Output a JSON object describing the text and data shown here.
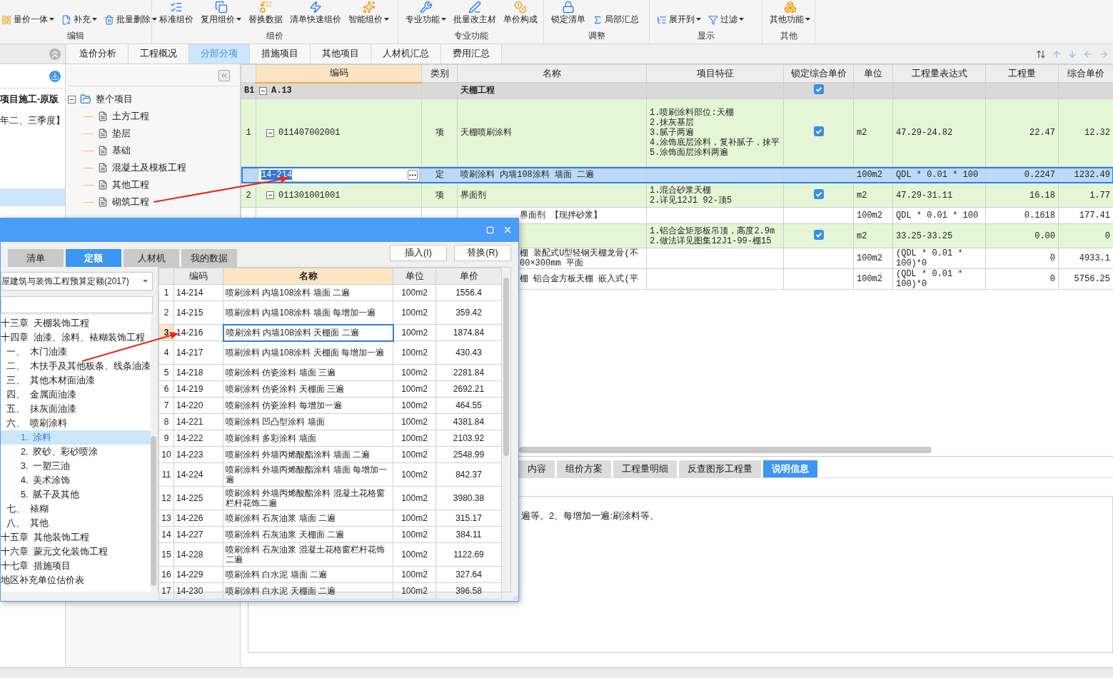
{
  "ribbon": {
    "groups": [
      {
        "label": "编辑",
        "buttons": [
          {
            "label": "量价一体",
            "kind": "small",
            "dropdown": true
          },
          {
            "label": "补充",
            "kind": "small",
            "dropdown": true
          },
          {
            "label": "批量删除",
            "kind": "small",
            "dropdown": true
          }
        ]
      },
      {
        "label": "组价",
        "buttons": [
          {
            "label": "标准组价",
            "kind": "large",
            "dropdown": false
          },
          {
            "label": "复用组价",
            "kind": "large",
            "dropdown": true
          },
          {
            "label": "替换数据",
            "kind": "large",
            "dropdown": false
          },
          {
            "label": "清单快速组价",
            "kind": "large",
            "dropdown": false
          },
          {
            "label": "智能组价",
            "kind": "large",
            "dropdown": true
          }
        ]
      },
      {
        "label": "专业功能",
        "buttons": [
          {
            "label": "专业功能",
            "kind": "large",
            "dropdown": true
          },
          {
            "label": "批量改主材",
            "kind": "large",
            "dropdown": false
          },
          {
            "label": "单价构成",
            "kind": "large",
            "dropdown": false
          }
        ]
      },
      {
        "label": "调整",
        "buttons": [
          {
            "label": "锁定清单",
            "kind": "large",
            "dropdown": false
          },
          {
            "label": "局部汇总",
            "kind": "small",
            "dropdown": false
          }
        ]
      },
      {
        "label": "显示",
        "buttons": [
          {
            "label": "展开到",
            "kind": "small",
            "dropdown": true
          },
          {
            "label": "过滤",
            "kind": "small",
            "dropdown": true
          }
        ]
      },
      {
        "label": "其他",
        "buttons": [
          {
            "label": "其他功能",
            "kind": "large",
            "dropdown": true
          }
        ]
      }
    ]
  },
  "main_tabs": [
    {
      "label": "造价分析",
      "selected": false
    },
    {
      "label": "工程概况",
      "selected": false
    },
    {
      "label": "分部分项",
      "selected": true
    },
    {
      "label": "措施项目",
      "selected": false
    },
    {
      "label": "其他项目",
      "selected": false
    },
    {
      "label": "人材机汇总",
      "selected": false
    },
    {
      "label": "费用汇总",
      "selected": false
    }
  ],
  "left_panel": {
    "lines": [
      "项目施工-原版",
      "年二、三季度】"
    ]
  },
  "project_tree": {
    "label": "整个项目",
    "expanded": true,
    "children": [
      {
        "label": "土方工程"
      },
      {
        "label": "垫层"
      },
      {
        "label": "基础"
      },
      {
        "label": "混凝土及模板工程"
      },
      {
        "label": "其他工程"
      },
      {
        "label": "砌筑工程"
      }
    ]
  },
  "main_table": {
    "columns": [
      {
        "label": "编码",
        "selected": true
      },
      {
        "label": "类别",
        "selected": false
      },
      {
        "label": "名称",
        "selected": false
      },
      {
        "label": "项目特征",
        "selected": false
      },
      {
        "label": "锁定综合单价",
        "selected": false
      },
      {
        "label": "单位",
        "selected": false
      },
      {
        "label": "工程量表达式",
        "selected": false
      },
      {
        "label": "工程量",
        "selected": false
      },
      {
        "label": "综合单价",
        "selected": false
      }
    ],
    "rows": [
      {
        "kind": "division",
        "no": "B1",
        "code": "A.13",
        "name": "天棚工程",
        "locked": true,
        "expanded": true,
        "selected": false
      },
      {
        "kind": "item",
        "no": "1",
        "code": "011407002001",
        "type": "项",
        "name": "天棚喷刷涂料",
        "features": [
          "1.喷刷涂料部位:天棚",
          "2.抹灰基层",
          "3.腻子两遍",
          "4.涂饰底层涂料，复补腻子，抹平",
          "5.涂饰面层涂料两遍"
        ],
        "locked": true,
        "expanded": true,
        "unit": "m2",
        "expr": "47.29-24.82",
        "qty": "22.47",
        "price": "12.32",
        "selected": false
      },
      {
        "kind": "sub",
        "code": "14-214",
        "type": "定",
        "name": "喷刷涂料 内墙108涂料 墙面 二遍",
        "unit": "100m2",
        "expr": "QDL * 0.01 * 100",
        "qty": "0.2247",
        "price": "1232.49",
        "selected": true
      },
      {
        "kind": "item",
        "no": "2",
        "code": "011301001001",
        "type": "项",
        "name": "界面剂",
        "features": [
          "1.混合砂浆天棚",
          "2.详见12J1 92-顶5"
        ],
        "locked": true,
        "expanded": true,
        "unit": "m2",
        "expr": "47.29-31.11",
        "qty": "16.18",
        "price": "1.77",
        "selected": false
      },
      {
        "kind": "sub",
        "name": "界面剂 【现拌砂浆】",
        "clipped": true,
        "unit": "100m2",
        "expr": "QDL * 0.01 * 100",
        "qty": "0.1618",
        "price": "177.41",
        "selected": false
      },
      {
        "kind": "item",
        "features": [
          "1.铝合金矩形板吊顶，高度2.9m",
          "2.做法详见图集12J1-99-棚15"
        ],
        "locked": true,
        "unit": "m2",
        "expr": "33.25-33.25",
        "qty": "0.00",
        "price": "0",
        "selected": false
      },
      {
        "kind": "sub",
        "name": "棚 装配式U型轻钢天棚龙骨(不\n00×300mm 平面",
        "clipped": true,
        "unit": "100m2",
        "expr": "(QDL * 0.01 * 100)*0",
        "qty": "0",
        "price": "4933.1",
        "selected": false
      },
      {
        "kind": "sub",
        "name": "棚 铝合金方板天棚 嵌入式(平",
        "clipped": true,
        "unit": "100m2",
        "expr": "(QDL * 0.01 * 100)*0",
        "qty": "0",
        "price": "5756.25",
        "selected": false
      }
    ]
  },
  "bottom_panel": {
    "tabs": [
      {
        "label": "内容",
        "selected": false
      },
      {
        "label": "组价方案",
        "selected": false
      },
      {
        "label": "工程量明细",
        "selected": false
      },
      {
        "label": "反查图形工程量",
        "selected": false
      },
      {
        "label": "说明信息",
        "selected": true
      }
    ],
    "text": "遍等。2、每增加一遍:刷涂料等。"
  },
  "dialog": {
    "tabs": [
      {
        "label": "清单",
        "selected": false
      },
      {
        "label": "定额",
        "selected": true
      },
      {
        "label": "人材机",
        "selected": false
      },
      {
        "label": "我的数据",
        "selected": false
      }
    ],
    "buttons": [
      "插入(I)",
      "替换(R)"
    ],
    "library": "屋建筑与装饰工程预算定额(2017)",
    "tree": [
      {
        "label": "十三章  天棚装饰工程",
        "selected": false
      },
      {
        "label": "十四章  油漆、涂料、裱糊装饰工程",
        "selected": false,
        "children": [
          {
            "label": "一、  木门油漆",
            "selected": false
          },
          {
            "label": "二、  木扶手及其他板条、线条油漆",
            "selected": false
          },
          {
            "label": "三、  其他木材面油漆",
            "selected": false
          },
          {
            "label": "四、  金属面油漆",
            "selected": false
          },
          {
            "label": "五、  抹灰面油漆",
            "selected": false
          },
          {
            "label": "六、  喷刷涂料",
            "selected": false,
            "children": [
              {
                "label": "1.  涂料",
                "selected": true
              },
              {
                "label": "2.  胶砂、彩砂喷涂",
                "selected": false
              },
              {
                "label": "3.  一塑三油",
                "selected": false
              },
              {
                "label": "4.  美术涂饰",
                "selected": false
              },
              {
                "label": "5.  腻子及其他",
                "selected": false
              }
            ]
          },
          {
            "label": "七、  裱糊",
            "selected": false
          },
          {
            "label": "八、  其他",
            "selected": false
          }
        ]
      },
      {
        "label": "十五章  其他装饰工程",
        "selected": false
      },
      {
        "label": "十六章  蒙元文化装饰工程",
        "selected": false
      },
      {
        "label": "十七章  措施项目",
        "selected": false
      },
      {
        "label": "地区补充单位估价表",
        "selected": false
      }
    ],
    "table": {
      "columns": [
        {
          "label": "编码",
          "selected": false
        },
        {
          "label": "名称",
          "selected": true
        },
        {
          "label": "单位",
          "selected": false
        },
        {
          "label": "单价",
          "selected": false
        }
      ],
      "rows": [
        {
          "no": "1",
          "code": "14-214",
          "name": "喷刷涂料 内墙108涂料 墙面 二遍",
          "unit": "100m2",
          "price": "1556.4",
          "selected": false
        },
        {
          "no": "2",
          "code": "14-215",
          "name": "喷刷涂料 内墙108涂料 墙面 每增加一遍",
          "unit": "100m2",
          "price": "359.42",
          "selected": false
        },
        {
          "no": "3",
          "code": "14-216",
          "name": "喷刷涂料 内墙108涂料 天棚面 二遍",
          "unit": "100m2",
          "price": "1874.84",
          "selected": true
        },
        {
          "no": "4",
          "code": "14-217",
          "name": "喷刷涂料 内墙108涂料 天棚面 每增加一遍",
          "unit": "100m2",
          "price": "430.43",
          "selected": false
        },
        {
          "no": "5",
          "code": "14-218",
          "name": "喷刷涂料 仿瓷涂料 墙面 三遍",
          "unit": "100m2",
          "price": "2281.84",
          "selected": false
        },
        {
          "no": "6",
          "code": "14-219",
          "name": "喷刷涂料 仿瓷涂料 天棚面 三遍",
          "unit": "100m2",
          "price": "2692.21",
          "selected": false
        },
        {
          "no": "7",
          "code": "14-220",
          "name": "喷刷涂料 仿瓷涂料 每增加一遍",
          "unit": "100m2",
          "price": "464.55",
          "selected": false
        },
        {
          "no": "8",
          "code": "14-221",
          "name": "喷刷涂料 凹凸型涂料 墙面",
          "unit": "100m2",
          "price": "4381.84",
          "selected": false
        },
        {
          "no": "9",
          "code": "14-222",
          "name": "喷刷涂料 多彩涂料 墙面",
          "unit": "100m2",
          "price": "2103.92",
          "selected": false
        },
        {
          "no": "10",
          "code": "14-223",
          "name": "喷刷涂料 外墙丙烯酸酯涂料 墙面 二遍",
          "unit": "100m2",
          "price": "2548.99",
          "selected": false
        },
        {
          "no": "11",
          "code": "14-224",
          "name": "喷刷涂料 外墙丙烯酸酯涂料 墙面 每增加一遍",
          "unit": "100m2",
          "price": "842.37",
          "selected": false
        },
        {
          "no": "12",
          "code": "14-225",
          "name": "喷刷涂料 外墙丙烯酸酯涂料 混凝土花格窗栏杆花饰二遍",
          "unit": "100m2",
          "price": "3980.38",
          "selected": false
        },
        {
          "no": "13",
          "code": "14-226",
          "name": "喷刷涂料 石灰油浆 墙面 二遍",
          "unit": "100m2",
          "price": "315.17",
          "selected": false
        },
        {
          "no": "14",
          "code": "14-227",
          "name": "喷刷涂料 石灰油浆 天棚面 二遍",
          "unit": "100m2",
          "price": "384.11",
          "selected": false
        },
        {
          "no": "15",
          "code": "14-228",
          "name": "喷刷涂料 石灰油浆 混凝土花格窗栏杆花饰二遍",
          "unit": "100m2",
          "price": "1122.69",
          "selected": false
        },
        {
          "no": "16",
          "code": "14-229",
          "name": "喷刷涂料 白水泥 墙面 二遍",
          "unit": "100m2",
          "price": "327.64",
          "selected": false
        },
        {
          "no": "17",
          "code": "14-230",
          "name": "喷刷涂料 白水泥 天棚面 二遍",
          "unit": "100m2",
          "price": "396.58",
          "selected": false
        }
      ]
    }
  }
}
